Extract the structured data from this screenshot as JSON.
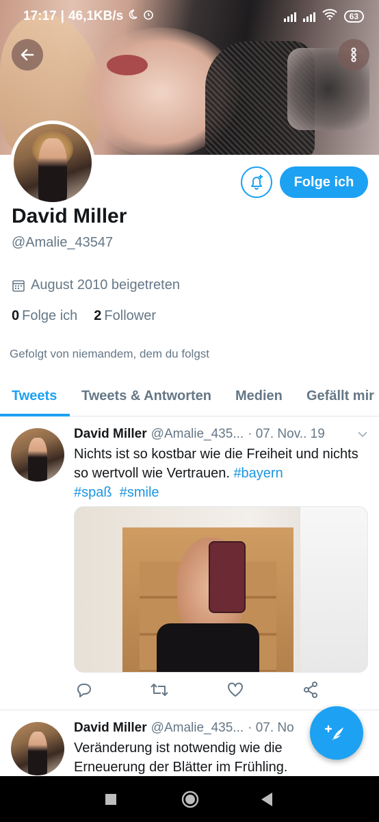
{
  "status_bar": {
    "time": "17:17",
    "speed": "46,1KB/s",
    "battery": "63",
    "icons": [
      "moon-icon",
      "alarm-icon",
      "signal-icon",
      "signal-icon",
      "wifi-icon",
      "battery-icon"
    ]
  },
  "header": {
    "back_icon": "arrow-left-icon",
    "more_icon": "more-vertical-icon"
  },
  "profile": {
    "name": "David Miller",
    "handle": "@Amalie_43547",
    "joined": "August 2010 beigetreten",
    "following_count": "0",
    "following_label": "Folge ich",
    "followers_count": "2",
    "followers_label": "Follower",
    "followed_by": "Gefolgt von niemandem, dem du folgst",
    "follow_button": "Folge ich",
    "bell_icon": "bell-plus-icon"
  },
  "tabs": [
    {
      "label": "Tweets",
      "active": true
    },
    {
      "label": "Tweets & Antworten",
      "active": false
    },
    {
      "label": "Medien",
      "active": false
    },
    {
      "label": "Gefällt mir",
      "active": false
    }
  ],
  "tweets": [
    {
      "name": "David Miller",
      "handle": "@Amalie_435...",
      "time": "· 07. Nov.. 19",
      "text_plain": "Nichts ist so kostbar wie die Freiheit und nichts so wertvoll wie Vertrauen. ",
      "hashtags": [
        "#bayern",
        "#spaß",
        "#smile"
      ],
      "has_image": true
    },
    {
      "name": "David Miller",
      "handle": "@Amalie_435...",
      "time": "· 07. No",
      "text_plain": "Veränderung ist notwendig wie die Erneuerung der Blätter im Frühling."
    }
  ],
  "tweet_actions": [
    "reply-icon",
    "retweet-icon",
    "like-icon",
    "share-icon"
  ],
  "fab_icon": "compose-tweet-icon",
  "accent_color": "#1da1f2"
}
